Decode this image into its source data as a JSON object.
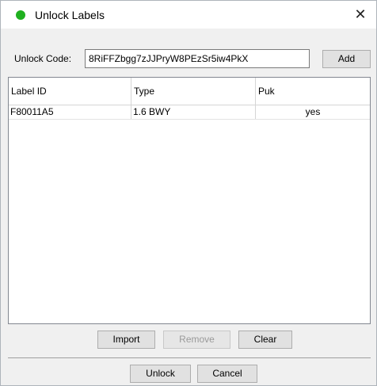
{
  "window": {
    "title": "Unlock Labels",
    "close_glyph": "✕",
    "status_color": "#20b020",
    "status_icon": "green-dot-icon"
  },
  "unlock_code": {
    "label": "Unlock Code:",
    "value": "8RiFFZbgg7zJJPryW8PEzSr5iw4PkX",
    "add_label": "Add"
  },
  "table": {
    "columns": [
      "Label ID",
      "Type",
      "Puk"
    ],
    "rows": [
      [
        "F80011A5",
        "1.6 BWY",
        "yes"
      ]
    ]
  },
  "actions": {
    "import_label": "Import",
    "remove_label": "Remove",
    "clear_label": "Clear"
  },
  "footer": {
    "unlock_label": "Unlock",
    "cancel_label": "Cancel"
  }
}
